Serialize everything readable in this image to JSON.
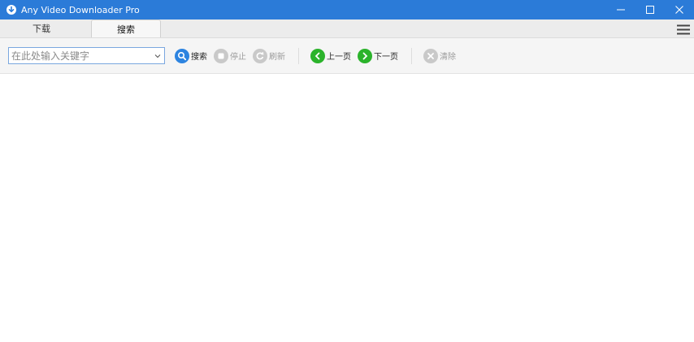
{
  "window": {
    "title": "Any Video Downloader Pro",
    "accent_color": "#2b7bd8",
    "controls": [
      "minimize-icon",
      "maximize-icon",
      "close-icon"
    ]
  },
  "tabs": [
    {
      "label": "下载",
      "active": false
    },
    {
      "label": "搜索",
      "active": true
    }
  ],
  "menu_icon": "hamburger-icon",
  "toolbar": {
    "search_placeholder": "在此处输入关键字",
    "search_value": "",
    "search_label": "搜索",
    "stop_label": "停止",
    "refresh_label": "刷新",
    "prev_label": "上一页",
    "next_label": "下一页",
    "clear_label": "清除"
  }
}
